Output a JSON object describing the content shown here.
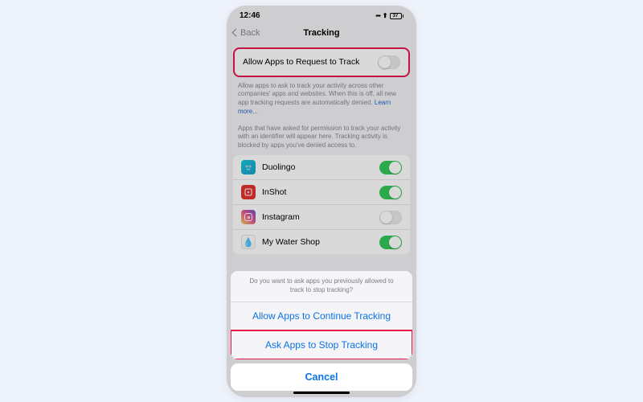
{
  "status": {
    "time": "12:46",
    "battery": "37"
  },
  "nav": {
    "back": "Back",
    "title": "Tracking"
  },
  "main_toggle": {
    "label": "Allow Apps to Request to Track",
    "on": false
  },
  "footer": {
    "text": "Allow apps to ask to track your activity across other companies' apps and websites. When this is off, all new app tracking requests are automatically denied.",
    "link": "Learn more..."
  },
  "section_note": "Apps that have asked for permission to track your activity with an identifier will appear here. Tracking activity is blocked by apps you've denied access to.",
  "apps": [
    {
      "name": "Duolingo",
      "icon": "duo",
      "on": true
    },
    {
      "name": "InShot",
      "icon": "inshot",
      "on": true
    },
    {
      "name": "Instagram",
      "icon": "ig",
      "on": false
    },
    {
      "name": "My Water Shop",
      "icon": "water",
      "on": true
    }
  ],
  "sheet": {
    "prompt": "Do you want to ask apps you previously allowed to track to stop tracking?",
    "action_continue": "Allow Apps to Continue Tracking",
    "action_stop": "Ask Apps to Stop Tracking",
    "cancel": "Cancel"
  }
}
